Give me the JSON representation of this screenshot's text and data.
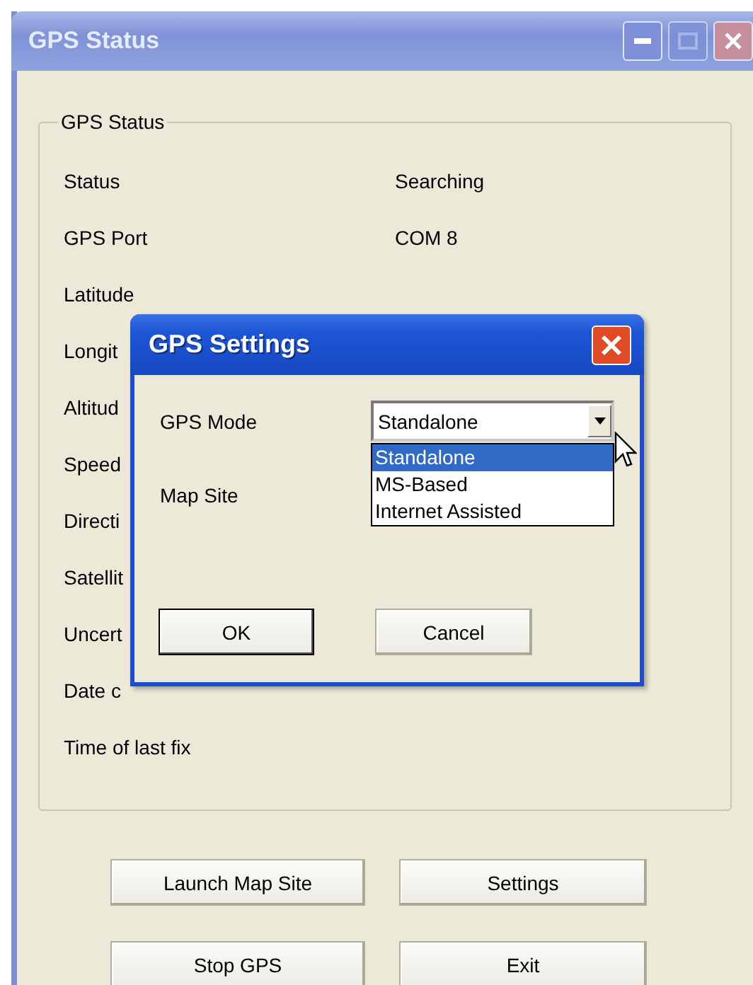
{
  "window": {
    "title": "GPS Status"
  },
  "status_group": {
    "legend": "GPS Status",
    "rows": [
      {
        "label": "Status",
        "value": "Searching"
      },
      {
        "label": "GPS Port",
        "value": "COM 8"
      },
      {
        "label": "Latitude"
      },
      {
        "label": "Longit"
      },
      {
        "label": "Altitud"
      },
      {
        "label": "Speed"
      },
      {
        "label": "Directi"
      },
      {
        "label": "Satellit"
      },
      {
        "label": "Uncert"
      },
      {
        "label": "Date c"
      },
      {
        "label": "Time of last fix"
      }
    ]
  },
  "buttons": [
    "Launch Map Site",
    "Settings",
    "Stop GPS",
    "Exit"
  ],
  "dialog": {
    "title": "GPS Settings",
    "fields": [
      {
        "label": "GPS Mode",
        "kind": "dropdown",
        "value": "Standalone",
        "expanded": true,
        "options": [
          {
            "label": "Standalone",
            "selected": true
          },
          {
            "label": "MS-Based",
            "selected": false
          },
          {
            "label": "Internet Assisted",
            "selected": false
          }
        ]
      },
      {
        "label": "Map Site",
        "kind": "label"
      }
    ],
    "buttons": [
      {
        "label": "OK",
        "default": true
      },
      {
        "label": "Cancel",
        "default": false
      }
    ]
  }
}
